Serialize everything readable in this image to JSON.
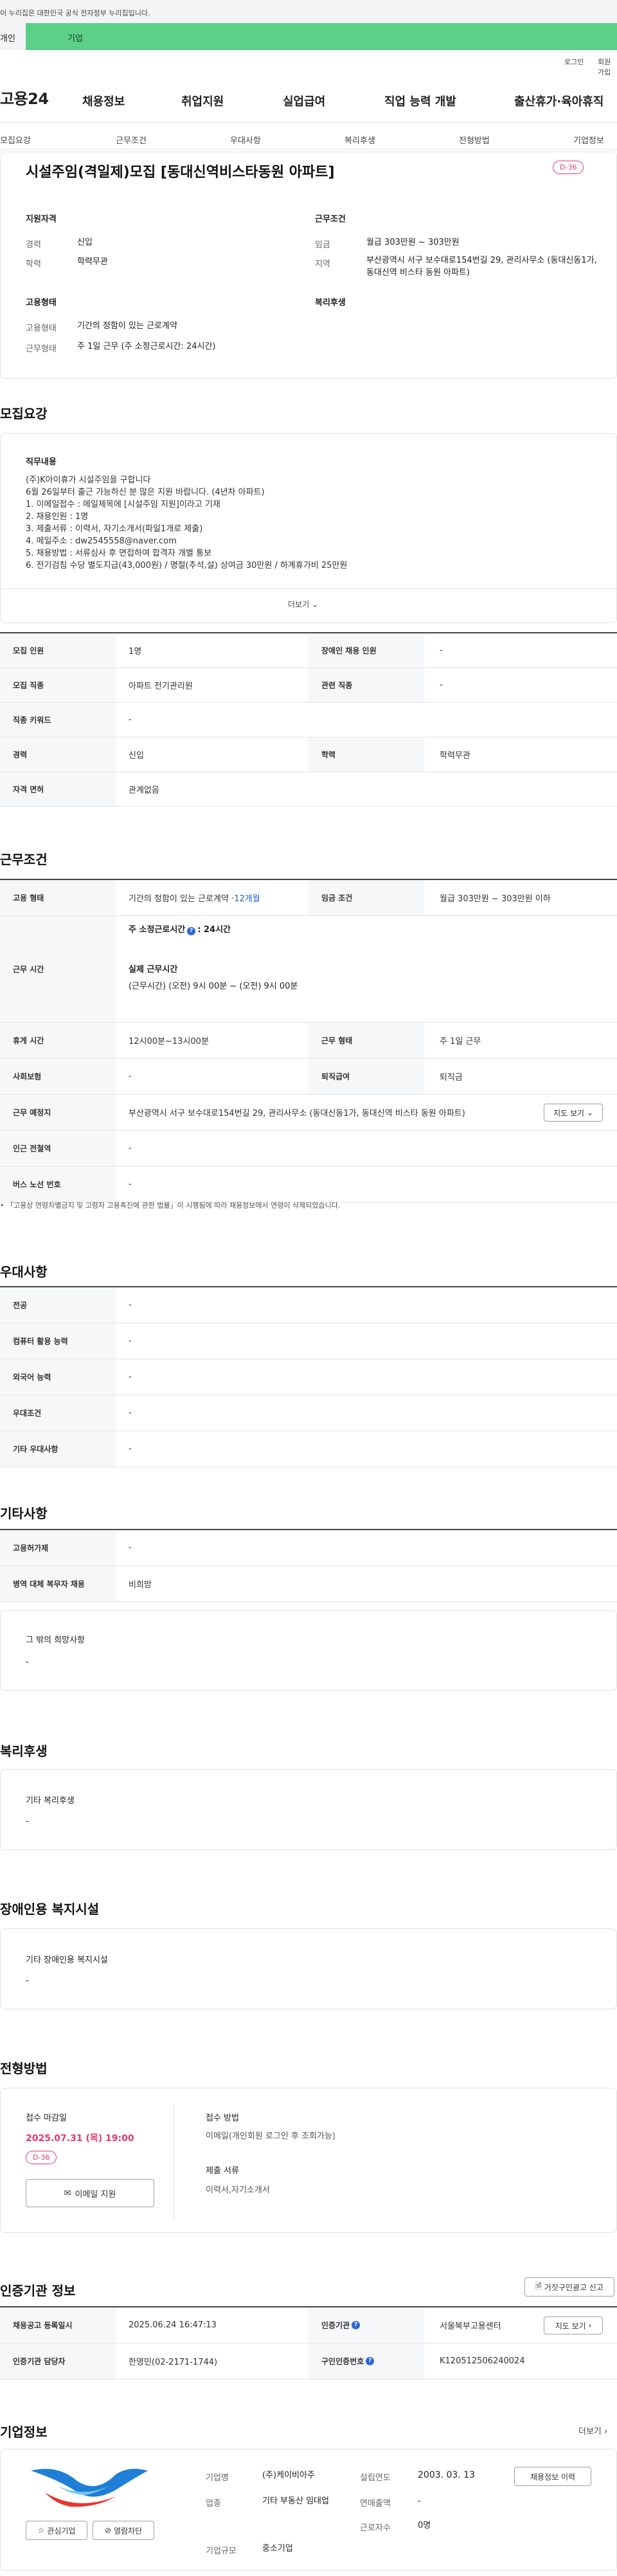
{
  "gov_banner": "이 누리집은 대한민국 공식 전자정부 누리집입니다.",
  "tabs": {
    "individual": "개인",
    "company": "기업"
  },
  "util": {
    "login": "로그인",
    "join": "회원가입"
  },
  "logo": "고용24",
  "gnb": [
    "채용정보",
    "취업지원",
    "실업급여",
    "직업 능력 개발",
    "출산휴가·육아휴직"
  ],
  "subnav": [
    "모집요강",
    "근무조건",
    "우대사항",
    "복리후생",
    "전형방법",
    "기업정보"
  ],
  "job": {
    "title": "시설주임(격일제)모집 [동대신역비스타동원 아파트]",
    "dday": "D-36",
    "qualification": {
      "heading": "지원자격",
      "career_label": "경력",
      "career": "신입",
      "edu_label": "학력",
      "edu": "학력무관"
    },
    "condition": {
      "heading": "근무조건",
      "wage_label": "임금",
      "wage": "월급 303만원 ~ 303만원",
      "location_label": "지역",
      "location": "부산광역시 서구 보수대로154번길 29, 관리사무소 (동대신동1가, 동대신역 비스타 동원 아파트)"
    },
    "employment": {
      "heading": "고용형태",
      "type_label": "고용형태",
      "type": "기간의 정함이 있는 근로계약",
      "shift_label": "근무형태",
      "shift": "주 1일 근무 (주 소정근로시간: 24시간)"
    },
    "welfare_heading": "복리후생"
  },
  "recruit": {
    "section_title": "모집요강",
    "desc_heading": "직무내용",
    "desc_lines": [
      "(주)K아이휴가 시설주임을 구합니다",
      "6월 26일부터 출근 가능하신 분 많은 지원 바랍니다. (4년차 아파트)",
      "1. 이메일접수 : 메일제목에 [시설주임 지원]이라고 기재",
      "2. 채용인원 : 1명",
      "3. 제출서류 : 이력서, 자기소개서(파일1개로 제출)",
      "4. 메일주소 : dw2545558@naver.com",
      "5. 채용방법 : 서류심사 후 면접하여 합격자 개별 통보",
      "6. 전기검침 수당 별도지급(43,000원) / 명절(추석,설) 상여금 30만원 / 하계휴가비 25만원"
    ],
    "more": "더보기",
    "rows": [
      {
        "k1": "모집 인원",
        "v1": "1명",
        "k2": "장애인 채용 인원",
        "v2": "-"
      },
      {
        "k1": "모집 직종",
        "v1": "아파트 전기관리원",
        "k2": "관련 직종",
        "v2": "-"
      },
      {
        "k1": "직종 키워드",
        "v1": "-"
      },
      {
        "k1": "경력",
        "v1": "신입",
        "k2": "학력",
        "v2": "학력무관"
      },
      {
        "k1": "자격 면허",
        "v1": "관계없음"
      }
    ]
  },
  "work": {
    "section_title": "근무조건",
    "emp_type_k": "고용 형태",
    "emp_type_v": "기간의 정함이 있는 근로계약 · ",
    "emp_type_months": "12개월",
    "wage_k": "임금 조건",
    "wage_v": "월급 303만원 ~ 303만원 이하",
    "hours_k": "근무 시간",
    "hours_weekly_label": "주 소정근로시간",
    "hours_weekly_icon": "?",
    "hours_weekly_v": ": 24시간",
    "hours_actual_label": "실제 근무시간",
    "hours_actual_v": "(근무시간) (오전) 9시 00분 ~ (오전) 9시 00분",
    "break_k": "휴게 시간",
    "break_v": "12시00분~13시00분",
    "shift_k": "근무 형태",
    "shift_v": "주 1일 근무",
    "insurance_k": "사회보험",
    "insurance_v": "-",
    "retire_k": "퇴직급여",
    "retire_v": "퇴직금",
    "place_k": "근무 예정지",
    "place_v": "부산광역시 서구 보수대로154번길 29, 관리사무소 (동대신동1가, 동대신역 비스타 동원 아파트)",
    "map_btn": "지도 보기",
    "subway_k": "인근 전철역",
    "subway_v": "-",
    "bus_k": "버스 노선 번호",
    "bus_v": "-",
    "note": "「고용상 연령차별금지 및 고령자 고용촉진에 관한 법률」이 시행됨에 따라 채용정보에서 연령이 삭제되었습니다."
  },
  "pref": {
    "section_title": "우대사항",
    "rows": [
      {
        "k": "전공",
        "v": "-"
      },
      {
        "k": "컴퓨터 활용 능력",
        "v": "-"
      },
      {
        "k": "외국어 능력",
        "v": "-"
      },
      {
        "k": "우대조건",
        "v": "-"
      },
      {
        "k": "기타 우대사항",
        "v": "-"
      }
    ]
  },
  "etc": {
    "section_title": "기타사항",
    "rows": [
      {
        "k": "고용허가제",
        "v": "-"
      },
      {
        "k": "병역 대체 복무자 채용",
        "v": "비희망"
      }
    ],
    "hope_heading": "그 밖의 희망사항",
    "hope_v": "-"
  },
  "welfare": {
    "section_title": "복리후생",
    "heading": "기타 복리후생",
    "v": "-"
  },
  "disability": {
    "section_title": "장애인용 복지시설",
    "heading": "기타 장애인용 복지시설",
    "v": "-"
  },
  "process": {
    "section_title": "전형방법",
    "deadline_label": "접수 마감일",
    "deadline": "2025.07.31 (목) 19:00",
    "dday": "D-36",
    "email_btn": "이메일 지원",
    "method_label": "접수 방법",
    "method": "이메일(개인회원 로그인 후 조회가능)",
    "docs_label": "제출 서류",
    "docs": "이력서,자기소개서"
  },
  "cert": {
    "section_title": "인증기관 정보",
    "report_btn": "거짓구인광고 신고",
    "reg_k": "채용공고 등록일시",
    "reg_v": "2025.06.24 16:47:13",
    "agency_k": "인증기관",
    "agency_v": "서울북부고용센터",
    "map_btn": "지도 보기",
    "manager_k": "인증기관 담당자",
    "manager_v": "한영민(02-2171-1744)",
    "reqno_k": "구인인증번호",
    "reqno_v": "K120512506240024"
  },
  "company": {
    "section_title": "기업정보",
    "more": "더보기",
    "name_k": "기업명",
    "name_v": "(주)케이비아주",
    "founded_k": "설립연도",
    "founded_v": "2003. 03. 13",
    "industry_k": "업종",
    "industry_v": "기타 부동산 임대업",
    "sales_k": "연매출액",
    "sales_v": "-",
    "employees_k": "근로자수",
    "employees_v": "0명",
    "size_k": "기업규모",
    "size_v": "중소기업",
    "history_btn": "채용정보 이력",
    "interest_btn": "관심기업",
    "block_btn": "열람차단"
  },
  "colors": {
    "accent_green": "#5ccf88",
    "dday_pink": "#e23b6a",
    "link_blue": "#1a5fd6"
  }
}
